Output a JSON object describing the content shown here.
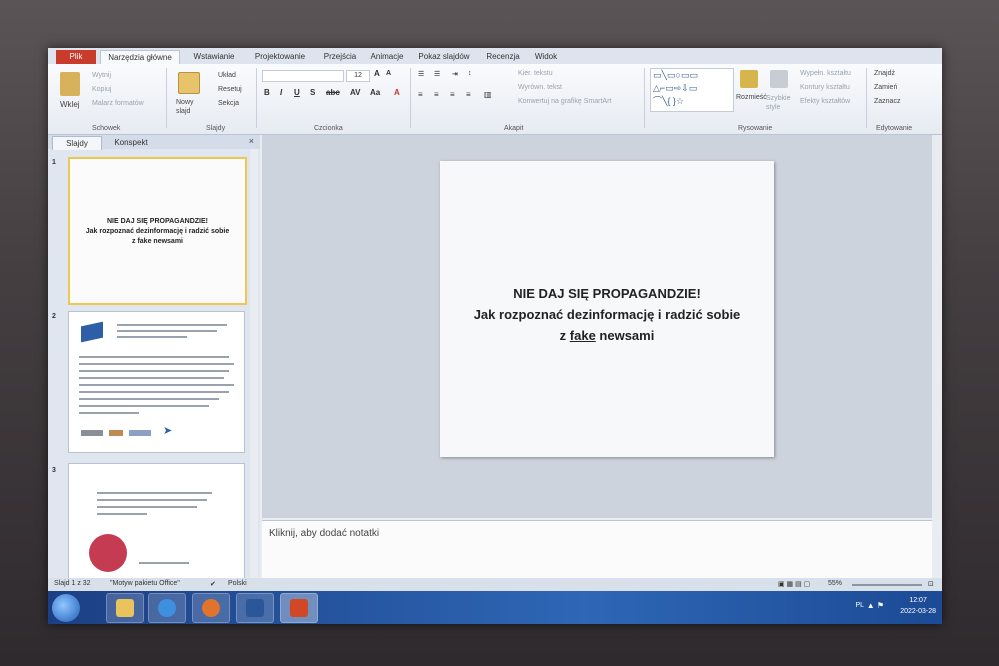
{
  "ribbon": {
    "tabs": [
      "Plik",
      "Narzędzia główne",
      "Wstawianie",
      "Projektowanie",
      "Przejścia",
      "Animacje",
      "Pokaz slajdów",
      "Recenzja",
      "Widok"
    ],
    "clipboard": {
      "paste": "Wklej",
      "cut": "Wytnij",
      "copy": "Kopiuj",
      "painter": "Malarz formatów",
      "group": "Schowek"
    },
    "slides": {
      "new_slide": "Nowy slajd",
      "layout": "Układ",
      "reset": "Resetuj",
      "section": "Sekcja",
      "group": "Slajdy"
    },
    "font": {
      "size": "12",
      "group": "Czcionka"
    },
    "paragraph": {
      "direction": "Kier. tekstu",
      "align": "Wyrówn. tekst",
      "smartart": "Konwertuj na grafikę SmartArt",
      "group": "Akapit"
    },
    "drawing": {
      "arrange": "Rozmieść",
      "quick_styles": "Szybkie style",
      "fill": "Wypełn. kształtu",
      "outline": "Kontury kształtu",
      "effects": "Efekty kształtów",
      "group": "Rysowanie"
    },
    "editing": {
      "find": "Znajdź",
      "replace": "Zamień",
      "select": "Zaznacz",
      "group": "Edytowanie"
    }
  },
  "side_panel": {
    "tabs": [
      "Slajdy",
      "Konspekt"
    ],
    "slides": [
      {
        "num": "1",
        "title_line1": "NIE DAJ SIĘ PROPAGANDZIE!",
        "title_line2": "Jak rozpoznać dezinformację i radzić sobie",
        "title_line3": "z fake newsami"
      },
      {
        "num": "2"
      },
      {
        "num": "3"
      }
    ]
  },
  "slide": {
    "line1": "NIE DAJ SIĘ PROPAGANDZIE!",
    "line2": "Jak rozpoznać dezinformację i radzić sobie",
    "line3_prefix": "z ",
    "line3_underlined": "fake",
    "line3_suffix": " newsami"
  },
  "notes_placeholder": "Kliknij, aby dodać notatki",
  "status": {
    "slide_counter": "Slajd 1 z 32",
    "theme": "\"Motyw pakietu Office\"",
    "language": "Polski",
    "zoom": "55%"
  },
  "taskbar": {
    "time": "12:07",
    "date": "2022-03-28",
    "lang": "PL"
  },
  "colors": {
    "accent": "#2e67b6",
    "file_tab": "#c93b2b",
    "selected_thumb": "#f1c64d"
  }
}
